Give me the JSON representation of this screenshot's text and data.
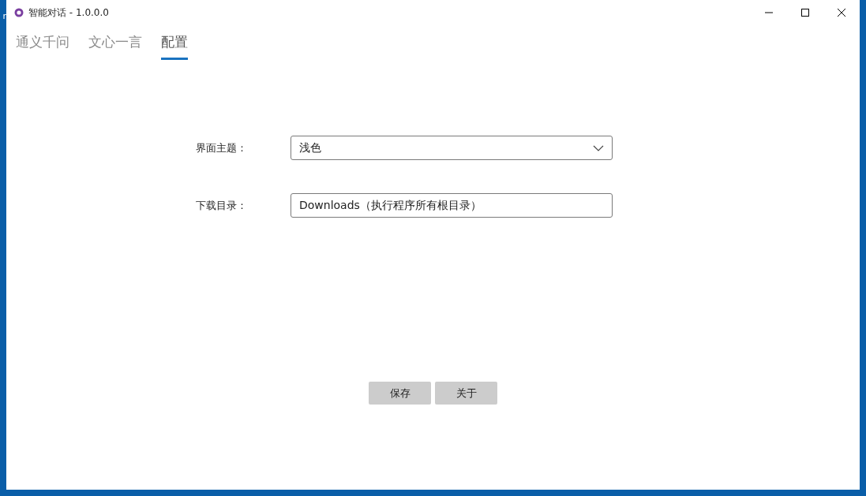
{
  "desktop_text": "r",
  "window": {
    "title": "智能对话 - 1.0.0.0"
  },
  "tabs": [
    {
      "label": "通义千问",
      "selected": false
    },
    {
      "label": "文心一言",
      "selected": false
    },
    {
      "label": "配置",
      "selected": true
    }
  ],
  "settings": [
    {
      "kind": "dropdown",
      "label": "界面主题：",
      "value": "浅色"
    },
    {
      "kind": "text",
      "label": "下载目录：",
      "value": "Downloads（执行程序所有根目录）"
    }
  ],
  "buttons": [
    "保存",
    "关于"
  ]
}
